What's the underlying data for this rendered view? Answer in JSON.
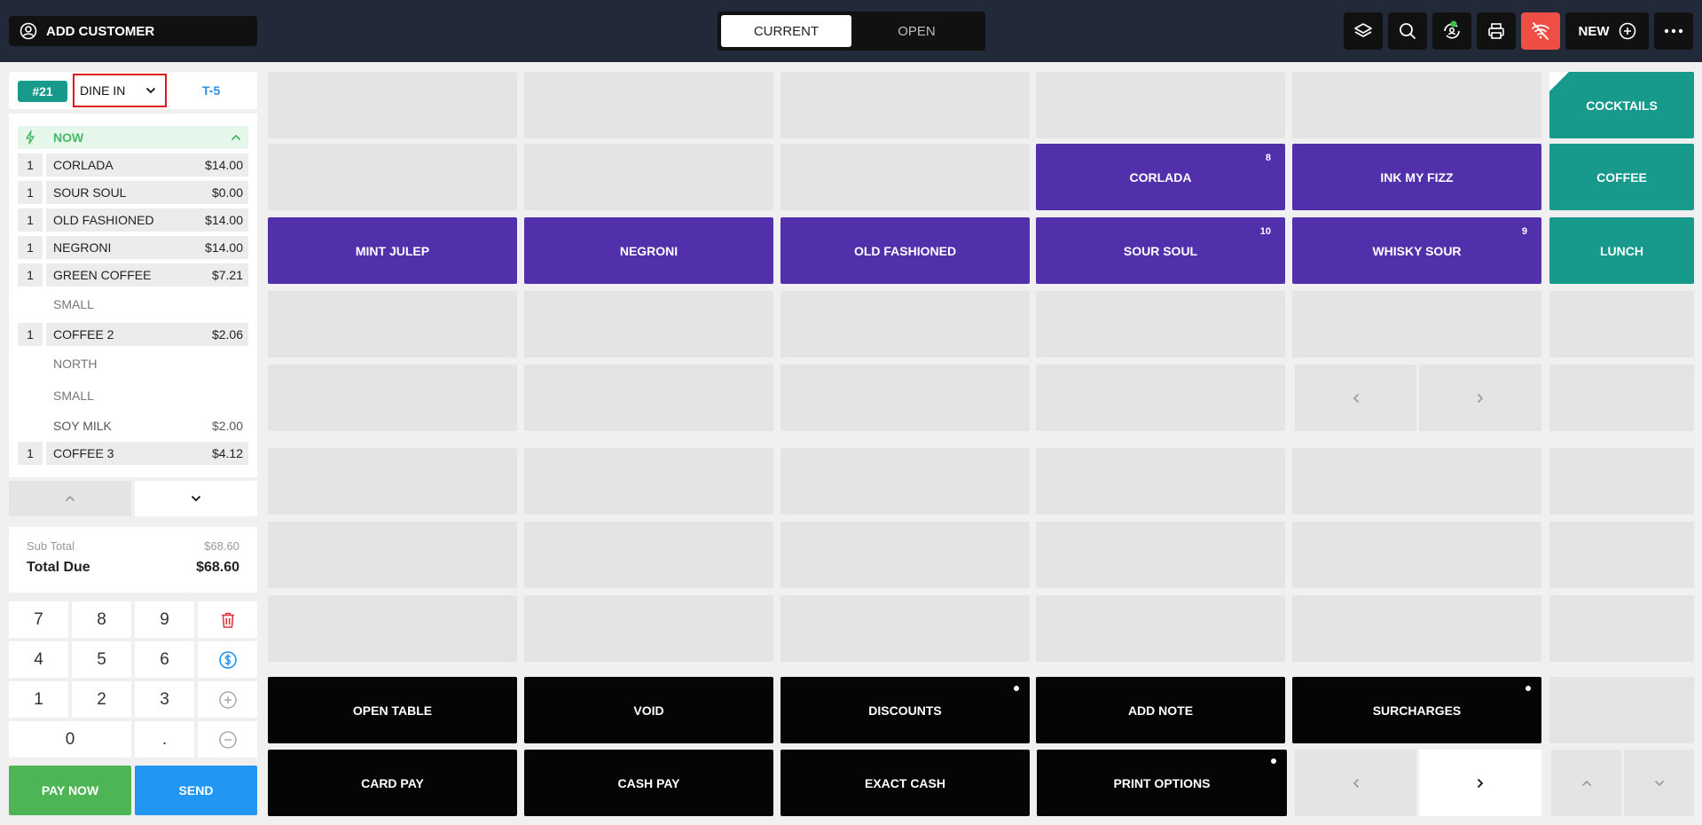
{
  "topbar": {
    "add_customer": "ADD CUSTOMER",
    "tabs": {
      "current": "CURRENT",
      "open": "OPEN"
    },
    "new_label": "NEW"
  },
  "order": {
    "number": "#21",
    "type": "DINE IN",
    "table": "T-5",
    "group_label": "NOW",
    "lines": [
      {
        "qty": "1",
        "name": "CORLADA",
        "price": "$14.00"
      },
      {
        "qty": "1",
        "name": "SOUR SOUL",
        "price": "$0.00"
      },
      {
        "qty": "1",
        "name": "OLD FASHIONED",
        "price": "$14.00"
      },
      {
        "qty": "1",
        "name": "NEGRONI",
        "price": "$14.00"
      },
      {
        "qty": "1",
        "name": "GREEN COFFEE",
        "price": "$7.21"
      },
      {
        "qty": "",
        "name": "SMALL",
        "price": ""
      },
      {
        "qty": "1",
        "name": "COFFEE 2",
        "price": "$2.06"
      },
      {
        "qty": "",
        "name": "NORTH",
        "price": ""
      },
      {
        "qty": "",
        "name": "SMALL",
        "price": ""
      },
      {
        "qty": "",
        "name": "SOY MILK",
        "price": "$2.00"
      },
      {
        "qty": "1",
        "name": "COFFEE 3",
        "price": "$4.12"
      }
    ],
    "sub_total_label": "Sub Total",
    "sub_total": "$68.60",
    "total_due_label": "Total Due",
    "total_due": "$68.60"
  },
  "keypad": {
    "k7": "7",
    "k8": "8",
    "k9": "9",
    "k4": "4",
    "k5": "5",
    "k6": "6",
    "k1": "1",
    "k2": "2",
    "k3": "3",
    "k0": "0",
    "kdot": "."
  },
  "actions": {
    "pay_now": "PAY NOW",
    "send": "SEND"
  },
  "products": {
    "corlada": {
      "label": "CORLADA",
      "count": "8"
    },
    "ink_my_fizz": {
      "label": "INK MY FIZZ"
    },
    "mint_julep": {
      "label": "MINT JULEP"
    },
    "negroni": {
      "label": "NEGRONI"
    },
    "old_fashioned": {
      "label": "OLD FASHIONED"
    },
    "sour_soul": {
      "label": "SOUR SOUL",
      "count": "10"
    },
    "whisky_sour": {
      "label": "WHISKY SOUR",
      "count": "9"
    }
  },
  "categories": {
    "cocktails": "COCKTAILS",
    "coffee": "COFFEE",
    "lunch": "LUNCH"
  },
  "functions": {
    "open_table": "OPEN TABLE",
    "void": "VOID",
    "discounts": "DISCOUNTS",
    "add_note": "ADD NOTE",
    "surcharges": "SURCHARGES",
    "card_pay": "CARD PAY",
    "cash_pay": "CASH PAY",
    "exact_cash": "EXACT CASH",
    "print_options": "PRINT OPTIONS"
  },
  "colors": {
    "topbar": "#222938",
    "teal": "#17998b",
    "purple": "#5230ab",
    "red": "#ef4e45",
    "green": "#4db556",
    "blue": "#2296f3"
  }
}
